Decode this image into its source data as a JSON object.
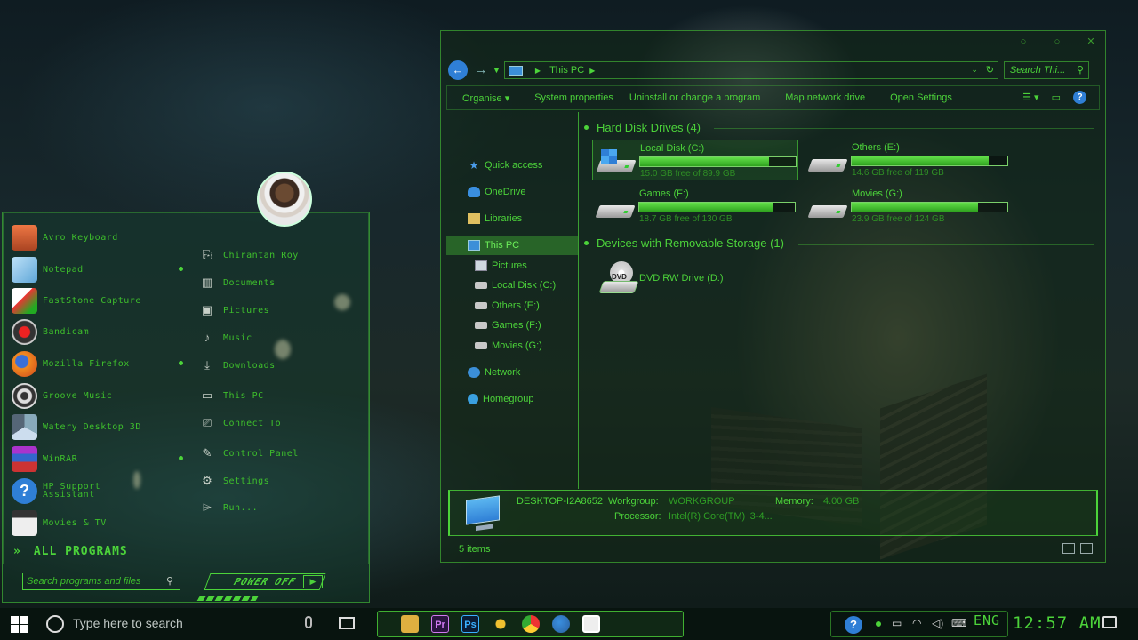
{
  "explorer": {
    "address": "This PC",
    "search_placeholder": "Search Thi...",
    "commands": [
      "Organise ▾",
      "System properties",
      "Uninstall or change a program",
      "Map network drive",
      "Open Settings"
    ],
    "nav": {
      "quick_access": "Quick access",
      "onedrive": "OneDrive",
      "libraries": "Libraries",
      "this_pc": "This PC",
      "pictures": "Pictures",
      "local_disk": "Local Disk (C:)",
      "others": "Others (E:)",
      "games": "Games (F:)",
      "movies": "Movies (G:)",
      "network": "Network",
      "homegroup": "Homegroup"
    },
    "hard_disk_header": "Hard Disk Drives (4)",
    "removable_header": "Devices with Removable Storage (1)",
    "drives": [
      {
        "name": "Local Disk (C:)",
        "free": "15.0 GB free of 89.9 GB",
        "used_fraction": 0.83
      },
      {
        "name": "Others (E:)",
        "free": "14.6 GB free of 119 GB",
        "used_fraction": 0.88
      },
      {
        "name": "Games (F:)",
        "free": "18.7 GB free of 130 GB",
        "used_fraction": 0.86
      },
      {
        "name": "Movies (G:)",
        "free": "23.9 GB free of 124 GB",
        "used_fraction": 0.81
      }
    ],
    "dvd": {
      "name": "DVD RW Drive (D:)",
      "label": "DVD"
    },
    "details": {
      "computer": "DESKTOP-I2A8652",
      "workgroup_label": "Workgroup:",
      "workgroup": "WORKGROUP",
      "memory_label": "Memory:",
      "memory": "4.00 GB",
      "processor_label": "Processor:",
      "processor": "Intel(R) Core(TM) i3-4..."
    },
    "status": "5 items"
  },
  "start_menu": {
    "apps": [
      "Avro Keyboard",
      "Notepad",
      "FastStone Capture",
      "Bandicam",
      "Mozilla Firefox",
      "Groove Music",
      "Watery Desktop 3D",
      "WinRAR",
      "HP Support Assistant",
      "Movies & TV"
    ],
    "places": [
      "Chirantan Roy",
      "Documents",
      "Pictures",
      "Music",
      "Downloads",
      "This PC",
      "Connect To",
      "Control Panel",
      "Settings",
      "Run..."
    ],
    "all_programs": "ALL PROGRAMS",
    "search_placeholder": "Search programs and files",
    "power_off": "POWER OFF"
  },
  "taskbar": {
    "search_placeholder": "Type here to search",
    "language": "ENG",
    "time": "12:57 AM"
  },
  "colors": {
    "accent": "#4cd33a",
    "accent_dark": "#2f9f25",
    "blue": "#2f7fd6"
  }
}
